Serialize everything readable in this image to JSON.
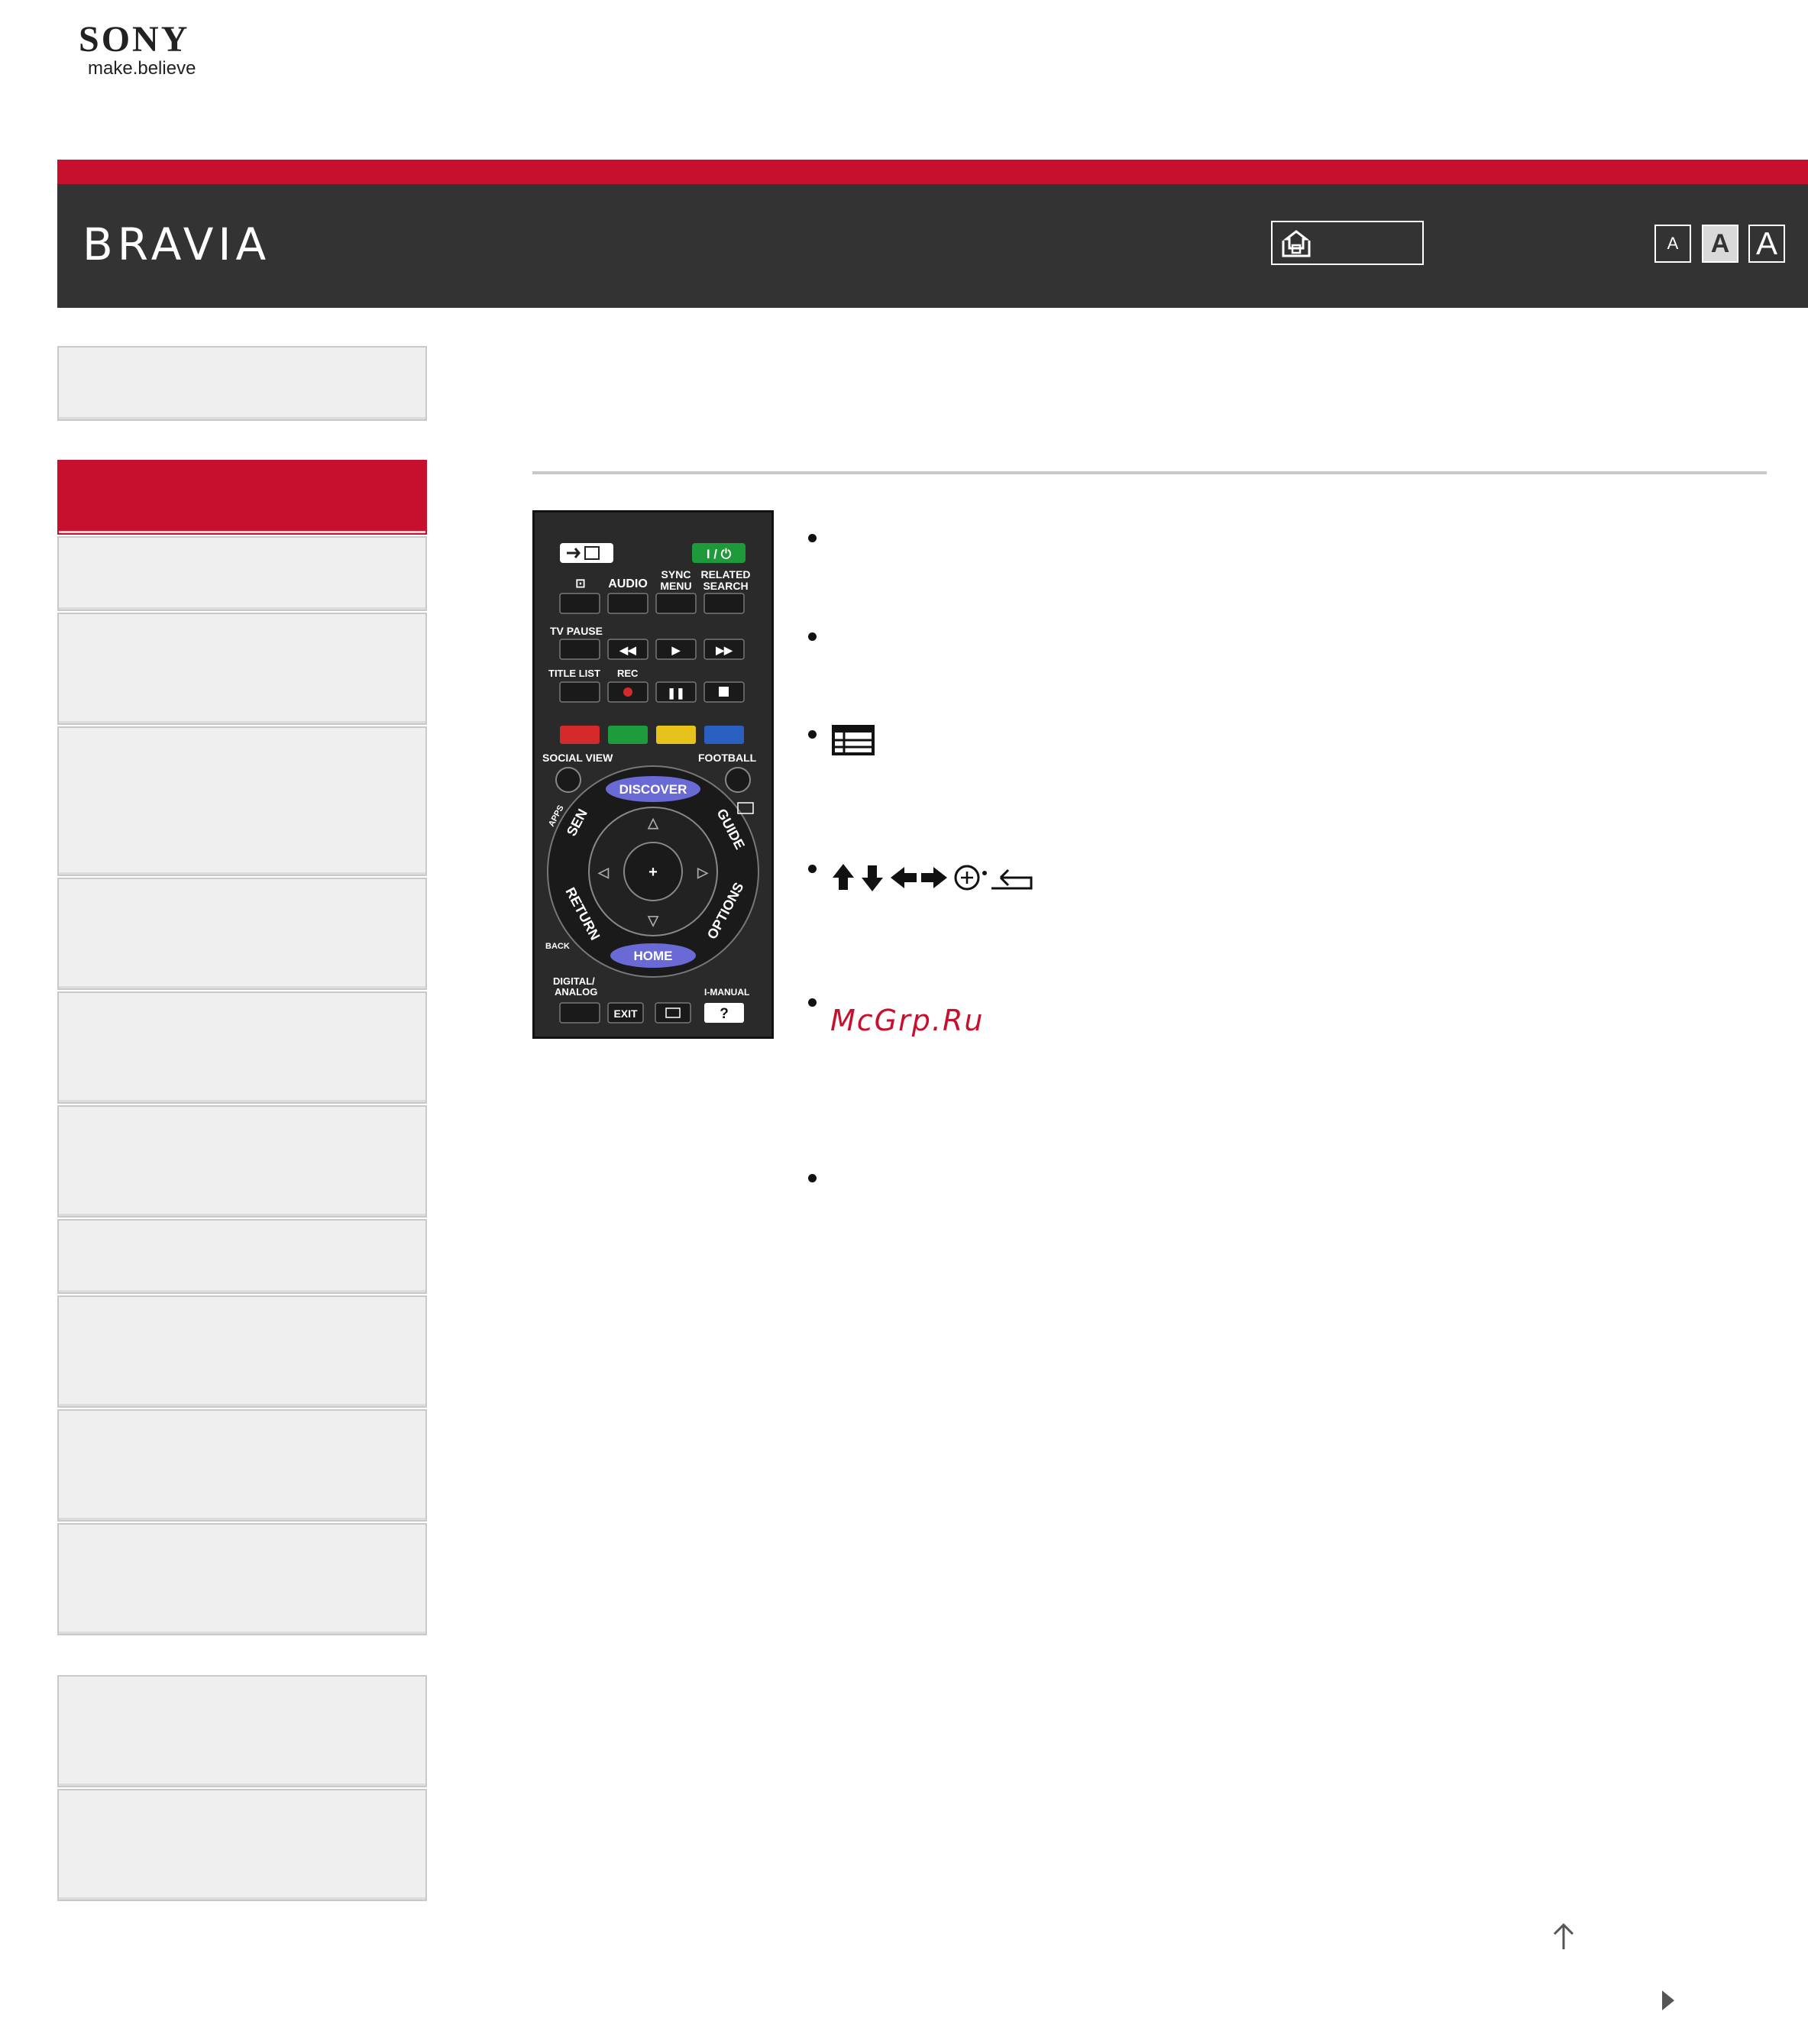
{
  "logo": {
    "brand": "SONY",
    "tagline": "make.believe"
  },
  "header": {
    "product": "BRAVIA",
    "font_size_buttons": [
      "A",
      "A",
      "A"
    ]
  },
  "sidebar": {
    "item_count": 14,
    "active_index": 1
  },
  "remote": {
    "labels": {
      "audio": "AUDIO",
      "sync_menu_1": "SYNC",
      "sync_menu_2": "MENU",
      "related_1": "RELATED",
      "related_2": "SEARCH",
      "tv_pause": "TV PAUSE",
      "title_list": "TITLE LIST",
      "rec": "REC",
      "social_view": "SOCIAL VIEW",
      "football": "FOOTBALL",
      "discover": "DISCOVER",
      "apps": "APPS",
      "sen": "SEN",
      "guide": "GUIDE",
      "return": "RETURN",
      "options": "OPTIONS",
      "back": "BACK",
      "home": "HOME",
      "digital_1": "DIGITAL/",
      "digital_2": "ANALOG",
      "i_manual": "I-MANUAL",
      "exit": "EXIT",
      "help": "?"
    },
    "colors": {
      "red": "#d42a2a",
      "green": "#1e9b3a",
      "yellow": "#e6c21a",
      "blue": "#2a5fc2",
      "power": "#1f9a3b",
      "oval": "#6a6ad6"
    }
  },
  "bullets": {
    "watermark": "McGrp.Ru"
  },
  "icons": {
    "up_icon": "arrow-up",
    "next_icon": "triangle-right"
  }
}
